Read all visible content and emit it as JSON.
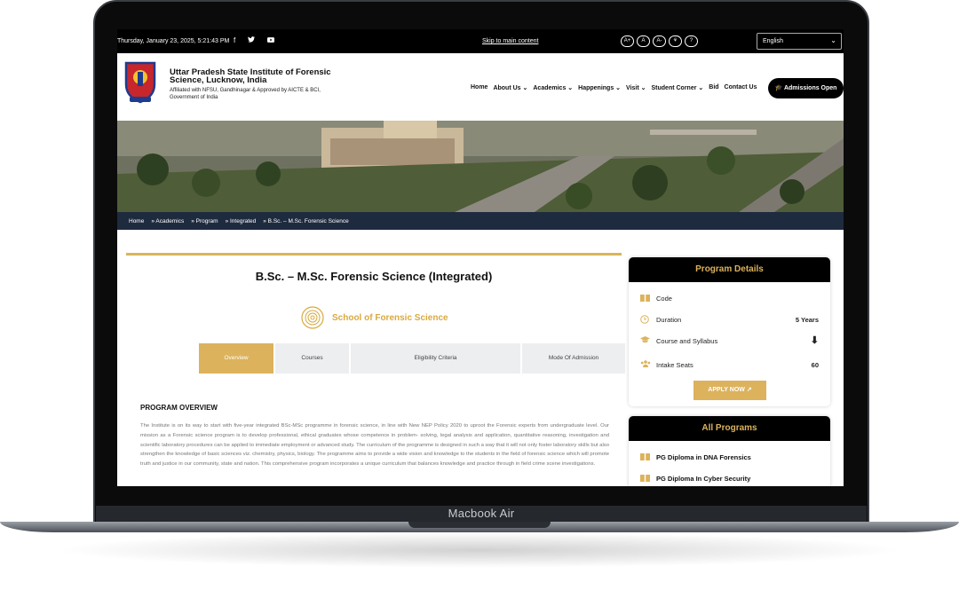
{
  "device": {
    "label": "Macbook Air"
  },
  "topbar": {
    "datetime": "Thursday, January 23, 2025, 5:21:43 PM",
    "social": [
      {
        "icon": "facebook-icon",
        "glyph": "f"
      },
      {
        "icon": "twitter-icon",
        "glyph": "🐦"
      },
      {
        "icon": "youtube-icon",
        "glyph": "▶"
      }
    ],
    "skip_link": "Skip to main content",
    "a11y": [
      "A+",
      "A",
      "A-",
      "⚘",
      "?"
    ],
    "language": "English"
  },
  "header": {
    "institute_name": "Uttar Pradesh State Institute of Forensic Science, Lucknow, India",
    "affiliation": "Affiliated with NFSU, Gandhinagar & Approved by AICTE & BCI, Government of India",
    "nav": [
      {
        "label": "Home",
        "dropdown": false
      },
      {
        "label": "About Us",
        "dropdown": true
      },
      {
        "label": "Academics",
        "dropdown": true
      },
      {
        "label": "Happenings",
        "dropdown": true
      },
      {
        "label": "Visit",
        "dropdown": true
      },
      {
        "label": "Student Corner",
        "dropdown": true
      },
      {
        "label": "Bid",
        "dropdown": false
      },
      {
        "label": "Contact Us",
        "dropdown": false
      }
    ],
    "cta": "Admissions Open"
  },
  "breadcrumb": [
    "Home",
    "» Academics",
    "» Program",
    "» Integrated",
    "» B.Sc. – M.Sc. Forensic Science"
  ],
  "main": {
    "title": "B.Sc. – M.Sc. Forensic Science (Integrated)",
    "school": "School of Forensic Science",
    "tabs": [
      {
        "label": "Overview",
        "active": true
      },
      {
        "label": "Courses",
        "active": false
      },
      {
        "label": "Eligibility Criteria",
        "active": false
      },
      {
        "label": "Mode Of Admission",
        "active": false
      }
    ],
    "overview_heading": "PROGRAM OVERVIEW",
    "overview_text": "The Institute is on its way to start with five-year integrated BSc-MSc programme in forensic science, in line with New NEP Policy 2020 to uproot the Forensic experts from undergraduate level. Our mission as a Forensic science program is to develop professional, ethical graduates whose competence in problem- solving, legal analysis and application, quantitative reasoning, investigation and scientific laboratory procedures can be applied to immediate employment or advanced study. The curriculum of the programme is designed in such a way that it will not only foster laboratory skills but also strengthen the knowledge of basic sciences viz. chemistry, physics, biology. The programme aims to provide a wide vision and knowledge to the students in the field of forensic science which will promote truth and justice in our community, state and nation. This comprehensive program incorporates a unique curriculum that balances knowledge and practice through in field crime scene investigations."
  },
  "program_details": {
    "heading": "Program Details",
    "rows": [
      {
        "icon": "book-icon",
        "glyph": "📖",
        "label": "Code",
        "value": ""
      },
      {
        "icon": "clock-icon",
        "glyph": "◷",
        "label": "Duration",
        "value": "5 Years"
      },
      {
        "icon": "graduation-cap-icon",
        "glyph": "🎓",
        "label": "Course and Syllabus",
        "value": "⬇"
      },
      {
        "icon": "users-icon",
        "glyph": "👥",
        "label": "Intake Seats",
        "value": "60"
      }
    ],
    "apply_label": "APPLY NOW ↗"
  },
  "all_programs": {
    "heading": "All Programs",
    "items": [
      "PG Diploma in DNA Forensics",
      "PG Diploma In Cyber Security"
    ]
  }
}
